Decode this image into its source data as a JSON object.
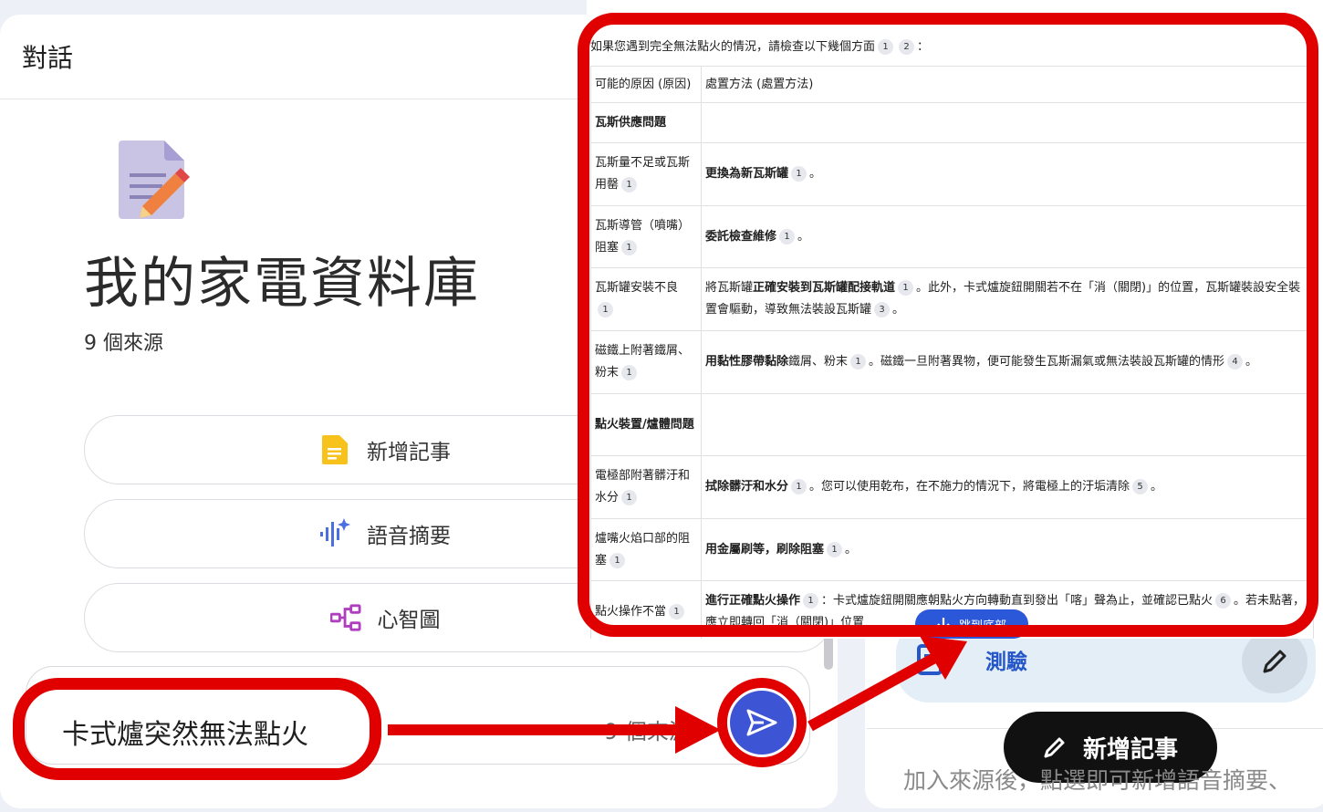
{
  "left_panel": {
    "title": "對話",
    "notebook_title": "我的家電資料庫",
    "source_count": "9 個來源",
    "actions": [
      {
        "label": "新增記事",
        "icon": "note-icon"
      },
      {
        "label": "語音摘要",
        "icon": "audio-waveform-icon"
      },
      {
        "label": "心智圖",
        "icon": "mind-map-icon"
      }
    ],
    "chat_input_value": "卡式爐突然無法點火",
    "chat_source_count": "9 個來源"
  },
  "answer": {
    "intro": "如果您遇到完全無法點火的情況，請檢查以下幾個方面",
    "intro_cites": [
      "1",
      "2"
    ],
    "intro_end": "：",
    "header": {
      "cause": "可能的原因 (原因)",
      "method": "處置方法 (處置方法)"
    },
    "rows": [
      {
        "type": "section",
        "cause": "瓦斯供應問題"
      },
      {
        "cause": "瓦斯量不足或瓦斯用罄",
        "cause_cite": "1",
        "method_bold": "更換為新瓦斯罐",
        "method_cite": "1",
        "method_rest": "。"
      },
      {
        "cause": "瓦斯導管（噴嘴）阻塞",
        "cause_cite": "1",
        "method_bold": "委託檢查維修",
        "method_cite": "1",
        "method_rest": "。"
      },
      {
        "cause": "瓦斯罐安裝不良",
        "cause_cite": "1",
        "method_pre": "將瓦斯罐",
        "method_bold": "正確安裝到瓦斯罐配接軌道",
        "method_cite": "1",
        "method_rest": "。此外，卡式爐旋鈕開關若不在「消（關閉)」的位置，瓦斯罐裝設安全裝置會驅動，導致無法裝設瓦斯罐",
        "method_cite2": "3",
        "method_rest2": "。"
      },
      {
        "cause": "磁鐵上附著鐵屑、粉末",
        "cause_cite": "1",
        "method_bold": "用黏性膠帶黏除",
        "method_pre2": "鐵屑、粉末",
        "method_cite": "1",
        "method_rest": "。磁鐵一旦附著異物，便可能發生瓦斯漏氣或無法裝設瓦斯罐的情形",
        "method_cite2": "4",
        "method_rest2": "。"
      },
      {
        "type": "section",
        "cause": "點火裝置/爐體問題"
      },
      {
        "cause": "電極部附著髒汙和水分",
        "cause_cite": "1",
        "method_bold": "拭除髒汙和水分",
        "method_cite": "1",
        "method_rest": "。您可以使用乾布，在不施力的情況下，將電極上的汙垢清除",
        "method_cite2": "5",
        "method_rest2": "。"
      },
      {
        "cause": "爐嘴火焰口部的阻塞",
        "cause_cite": "1",
        "method_bold": "用金屬刷等，刷除阻塞",
        "method_cite": "1",
        "method_rest": "。"
      },
      {
        "cause": "點火操作不當",
        "cause_cite": "1",
        "method_bold": "進行正確點火操作",
        "method_cite": "1",
        "method_rest": "：卡式爐旋鈕開關應朝點火方向轉動直到發出「喀」聲為止，並確認已點火",
        "method_cite2": "6",
        "method_rest2": "。若未點著，應立即轉回「消（關閉)」位置"
      }
    ],
    "jump_label": "跳到底部"
  },
  "right_panel": {
    "quiz_label": "測驗",
    "fab_label": "新增記事",
    "hint": "加入來源後，點選即可新增語音摘要、"
  },
  "colors": {
    "accent": "#3d55d4",
    "highlight": "#e00000",
    "quiz_bg": "#e3eef7"
  }
}
